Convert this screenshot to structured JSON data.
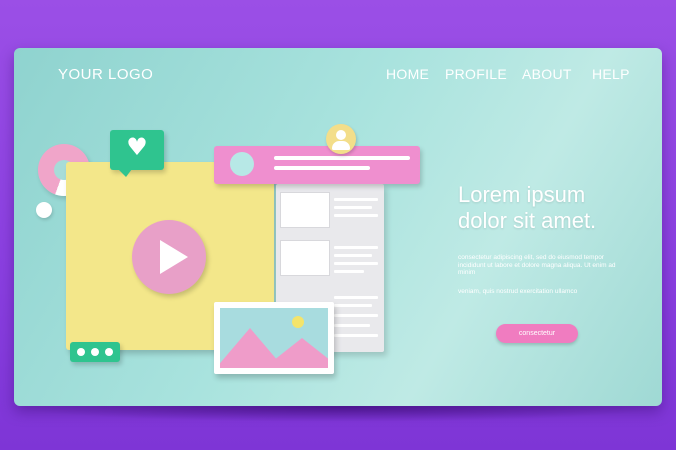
{
  "logo": "YOUR LOGO",
  "nav": {
    "home": "HOME",
    "profile": "PROFILE",
    "about": "ABOUT",
    "help": "HELP"
  },
  "hero": {
    "headline_line1": "Lorem ipsum",
    "headline_line2": "dolor sit amet.",
    "paragraph": "consectetur adipiscing elit, sed do eiusmod tempor incididunt ut labore et dolore magna aliqua. Ut enim ad minim",
    "paragraph2": "veniam, quis nostrud exercitation ullamco",
    "cta_label": "consectetur"
  },
  "colors": {
    "background": "#8a3fe0",
    "page": "#a9e3de",
    "pink": "#ef8fcf",
    "yellow": "#f3e78a",
    "green": "#2fc48f"
  },
  "icons": {
    "play": "play-icon",
    "heart": "heart-icon",
    "avatar": "user-avatar-icon",
    "donut": "donut-chart-icon",
    "image": "image-icon",
    "chat": "chat-bubble-icon"
  }
}
